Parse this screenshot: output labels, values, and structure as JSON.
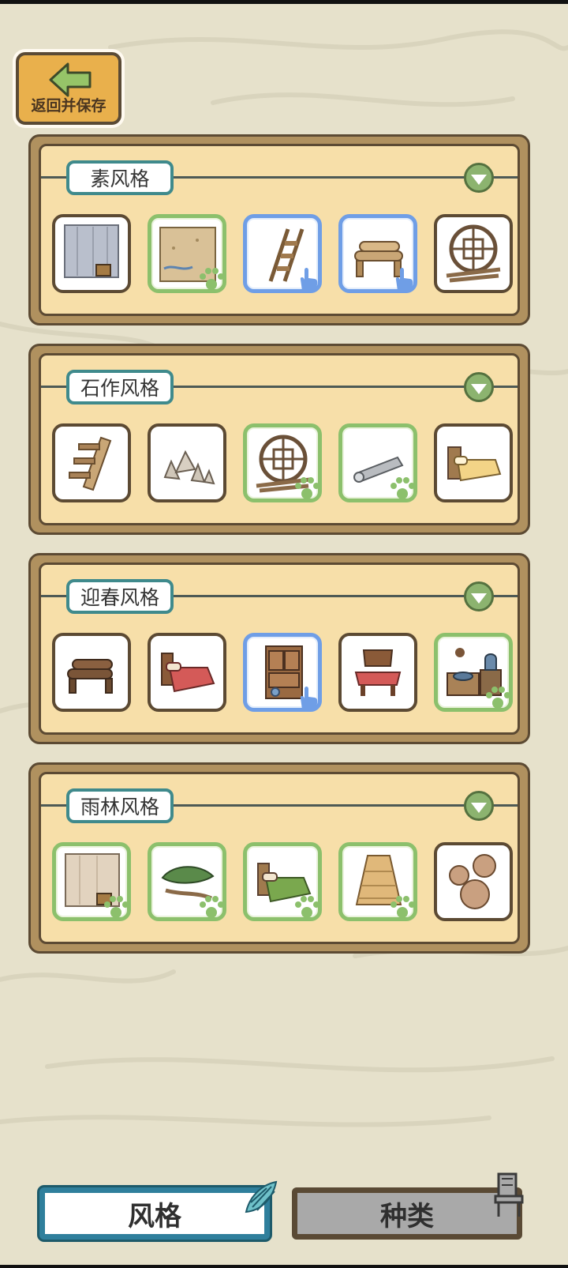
{
  "back_button": {
    "label": "返回并保存",
    "icon": "left-arrow-icon"
  },
  "panels": [
    {
      "title": "素风格",
      "items": [
        {
          "name": "grey-curtain-with-bucket",
          "state": "normal"
        },
        {
          "name": "straw-mat",
          "state": "owned"
        },
        {
          "name": "wooden-ladder",
          "state": "selected"
        },
        {
          "name": "log-bench",
          "state": "selected"
        },
        {
          "name": "round-lattice-window",
          "state": "normal"
        }
      ]
    },
    {
      "title": "石作风格",
      "items": [
        {
          "name": "wooden-stairs",
          "state": "normal"
        },
        {
          "name": "stone-pile",
          "state": "normal"
        },
        {
          "name": "round-lattice-window",
          "state": "owned"
        },
        {
          "name": "rolled-rug",
          "state": "owned"
        },
        {
          "name": "yellow-bed",
          "state": "normal"
        }
      ]
    },
    {
      "title": "迎春风格",
      "items": [
        {
          "name": "log-stack",
          "state": "normal"
        },
        {
          "name": "red-bed",
          "state": "normal"
        },
        {
          "name": "wooden-cabinet",
          "state": "selected"
        },
        {
          "name": "red-cushion-chair",
          "state": "normal"
        },
        {
          "name": "stove-with-kettle",
          "state": "owned"
        }
      ]
    },
    {
      "title": "雨林风格",
      "items": [
        {
          "name": "beige-curtain-with-bucket",
          "state": "owned"
        },
        {
          "name": "leaf-hammock",
          "state": "owned"
        },
        {
          "name": "green-bed",
          "state": "owned"
        },
        {
          "name": "woven-basket",
          "state": "owned"
        },
        {
          "name": "wood-slices",
          "state": "normal"
        }
      ]
    }
  ],
  "tabs": {
    "style_label": "风格",
    "kind_label": "种类",
    "active": "风格"
  },
  "colors": {
    "owned_border": "#8cc06c",
    "selected_border": "#6f9ee6",
    "panel_frame": "#b0915f",
    "panel_fill": "#f7dfa9"
  }
}
